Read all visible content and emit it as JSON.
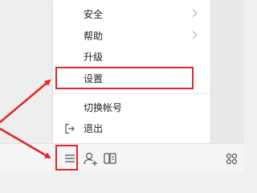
{
  "menu": {
    "items": [
      {
        "label": "安全",
        "has_submenu": true
      },
      {
        "label": "帮助",
        "has_submenu": true
      },
      {
        "label": "升级",
        "has_submenu": false
      },
      {
        "label": "设置",
        "has_submenu": false,
        "highlighted": true
      },
      {
        "label": "切换帐号",
        "has_submenu": false
      },
      {
        "label": "退出",
        "has_submenu": false,
        "icon": "logout-icon"
      }
    ]
  },
  "toolbar": {
    "buttons": [
      {
        "name": "main-menu",
        "icon": "hamburger-menu-icon"
      },
      {
        "name": "add-contact",
        "icon": "add-user-icon"
      },
      {
        "name": "file-manager",
        "icon": "files-icon"
      },
      {
        "name": "apps",
        "icon": "grid-icon"
      }
    ]
  },
  "colors": {
    "annotation_red": "#e02828",
    "menu_bg": "#ffffff",
    "toolbar_bg": "#f5f5f5"
  }
}
